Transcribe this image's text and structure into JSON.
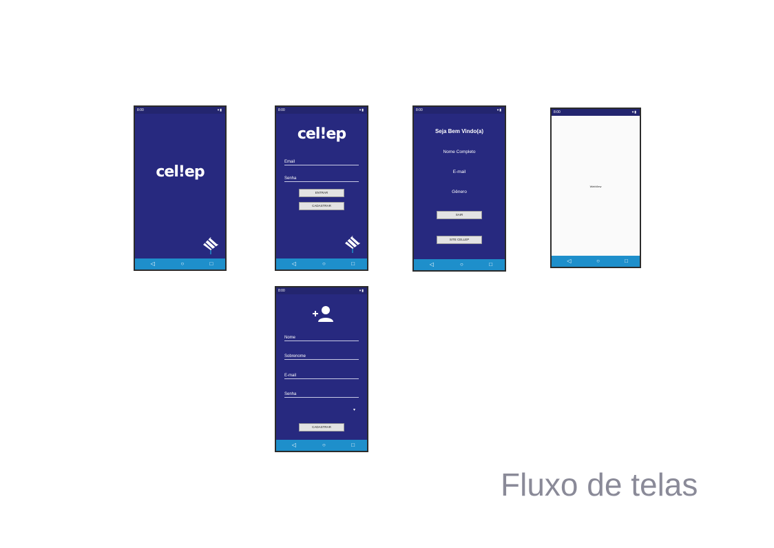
{
  "status_bar": {
    "time": "8:00",
    "icons": "▾▮"
  },
  "nav": {
    "back": "◁",
    "home": "○",
    "recent": "□"
  },
  "splash": {
    "logo": "cel!ep"
  },
  "login": {
    "logo": "cel!ep",
    "email_label": "Email",
    "password_label": "Senha",
    "enter_button": "ENTRAR",
    "register_button": "CADASTRAR"
  },
  "welcome": {
    "title": "Seja Bem Vindo(a)",
    "name_label": "Nome Completo",
    "email_label": "E-mail",
    "gender_label": "Gênero",
    "exit_button": "SAIR",
    "site_button": "SITE CELLEP"
  },
  "webview": {
    "label": "WebView"
  },
  "register": {
    "name_label": "Nome",
    "surname_label": "Sobrenome",
    "email_label": "E-mail",
    "password_label": "Senha",
    "dropdown_arrow": "▾",
    "register_button": "CADASTRAR"
  },
  "caption": "Fluxo de telas",
  "colors": {
    "phone_bg": "#27297f",
    "nav_bar": "#1e8fcb",
    "button_bg": "#e3e3e3",
    "caption": "#8a8a98"
  }
}
